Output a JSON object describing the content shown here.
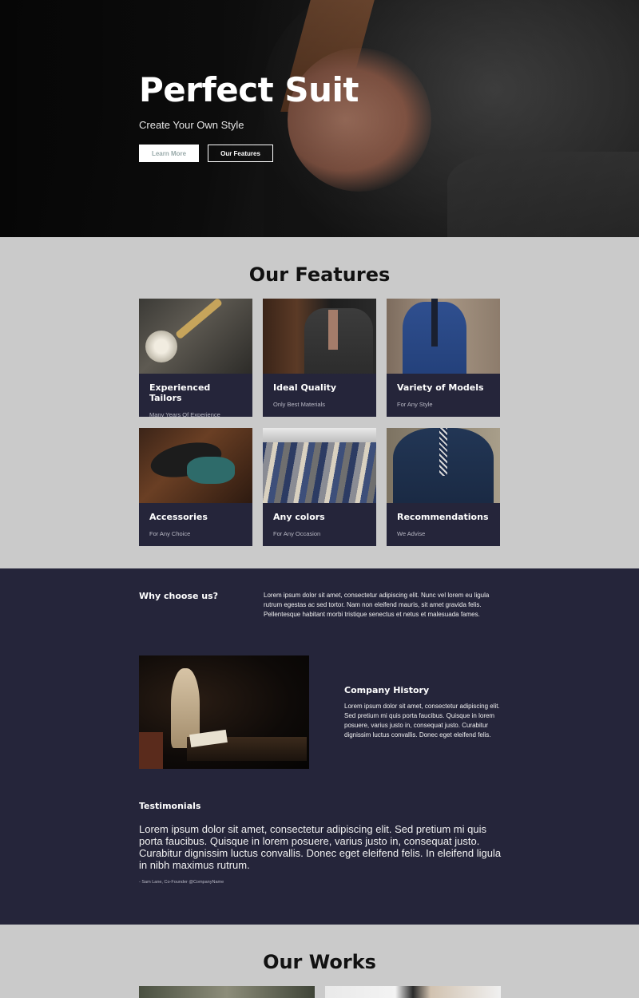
{
  "hero": {
    "title": "Perfect Suit",
    "subtitle": "Create Your Own Style",
    "btn_learn": "Learn More",
    "btn_features": "Our Features"
  },
  "features": {
    "title": "Our Features",
    "cards": [
      {
        "title": "Experienced Tailors",
        "subtitle": "Many Years Of Experience"
      },
      {
        "title": "Ideal Quality",
        "subtitle": "Only Best Materials"
      },
      {
        "title": "Variety of Models",
        "subtitle": "For Any Style"
      },
      {
        "title": "Accessories",
        "subtitle": "For Any Choice"
      },
      {
        "title": "Any colors",
        "subtitle": "For Any Occasion"
      },
      {
        "title": "Recommendations",
        "subtitle": "We Advise"
      }
    ]
  },
  "about": {
    "why_title": "Why choose us?",
    "why_text": "Lorem ipsum dolor sit amet, consectetur adipiscing elit. Nunc vel lorem eu ligula rutrum egestas ac sed tortor. Nam non eleifend mauris, sit amet gravida felis. Pellentesque habitant morbi tristique senectus et netus et malesuada fames.",
    "history_title": "Company History",
    "history_text": "Lorem ipsum dolor sit amet, consectetur adipiscing elit. Sed pretium mi quis porta faucibus. Quisque in lorem posuere, varius justo in, consequat justo. Curabitur dignissim luctus convallis. Donec eget eleifend felis.",
    "testimonials_title": "Testimonials",
    "testimonial_quote": "Lorem ipsum dolor sit amet, consectetur adipiscing elit. Sed pretium mi quis porta faucibus. Quisque in lorem posuere, varius justo in, consequat justo. Curabitur dignissim luctus convallis. Donec eget eleifend felis. In eleifend ligula in nibh maximus rutrum.",
    "testimonial_author": "- Sam Lane, Co-Founder @CompanyName"
  },
  "works": {
    "title": "Our Works"
  },
  "colors": {
    "dark_navy": "#25253a",
    "light_gray": "#cacaca"
  }
}
